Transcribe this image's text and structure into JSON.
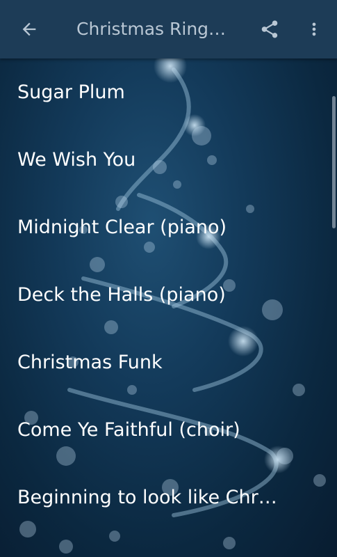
{
  "toolbar": {
    "title": "Christmas Ring…",
    "back_icon": "arrow-back-icon",
    "share_icon": "share-icon",
    "more_icon": "more-vert-icon"
  },
  "ringtones": [
    {
      "label": "Sugar Plum"
    },
    {
      "label": "We Wish You"
    },
    {
      "label": "Midnight Clear (piano)"
    },
    {
      "label": "Deck the Halls (piano)"
    },
    {
      "label": "Christmas Funk"
    },
    {
      "label": "Come Ye Faithful (choir)"
    },
    {
      "label": "Beginning to look like Chr…"
    }
  ],
  "colors": {
    "appbar": "#1d3c57",
    "background": "#133a5a",
    "text": "#ffffff",
    "title": "#b9c7d4"
  }
}
